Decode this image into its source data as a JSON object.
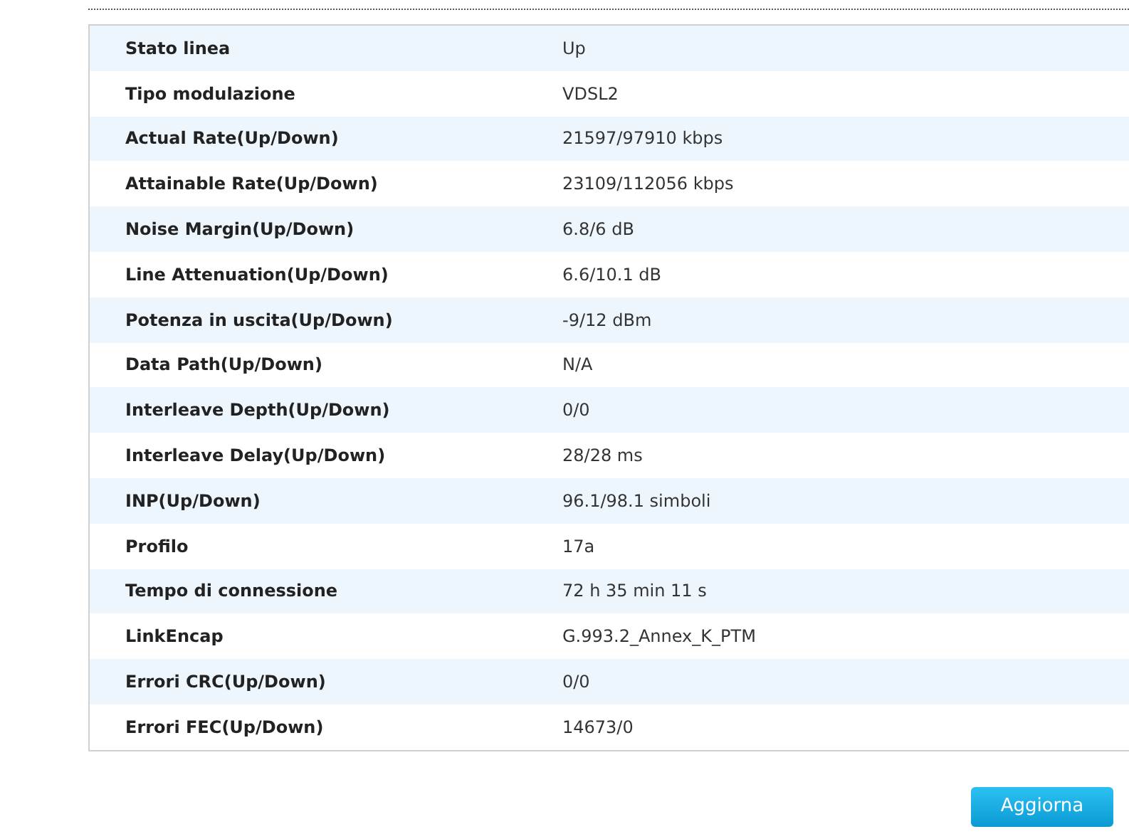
{
  "rows": [
    {
      "label": "Stato linea",
      "value": "Up"
    },
    {
      "label": "Tipo modulazione",
      "value": "VDSL2"
    },
    {
      "label": "Actual Rate(Up/Down)",
      "value": "21597/97910 kbps"
    },
    {
      "label": "Attainable Rate(Up/Down)",
      "value": "23109/112056 kbps"
    },
    {
      "label": "Noise Margin(Up/Down)",
      "value": "6.8/6 dB"
    },
    {
      "label": "Line Attenuation(Up/Down)",
      "value": "6.6/10.1 dB"
    },
    {
      "label": "Potenza in uscita(Up/Down)",
      "value": "-9/12 dBm"
    },
    {
      "label": "Data Path(Up/Down)",
      "value": "N/A"
    },
    {
      "label": "Interleave Depth(Up/Down)",
      "value": "0/0"
    },
    {
      "label": "Interleave Delay(Up/Down)",
      "value": "28/28 ms"
    },
    {
      "label": "INP(Up/Down)",
      "value": "96.1/98.1 simboli"
    },
    {
      "label": "Profilo",
      "value": "17a"
    },
    {
      "label": "Tempo di connessione",
      "value": "72 h 35 min 11 s"
    },
    {
      "label": "LinkEncap",
      "value": "G.993.2_Annex_K_PTM"
    },
    {
      "label": "Errori CRC(Up/Down)",
      "value": "0/0"
    },
    {
      "label": "Errori FEC(Up/Down)",
      "value": "14673/0"
    }
  ],
  "button": "Aggiorna"
}
